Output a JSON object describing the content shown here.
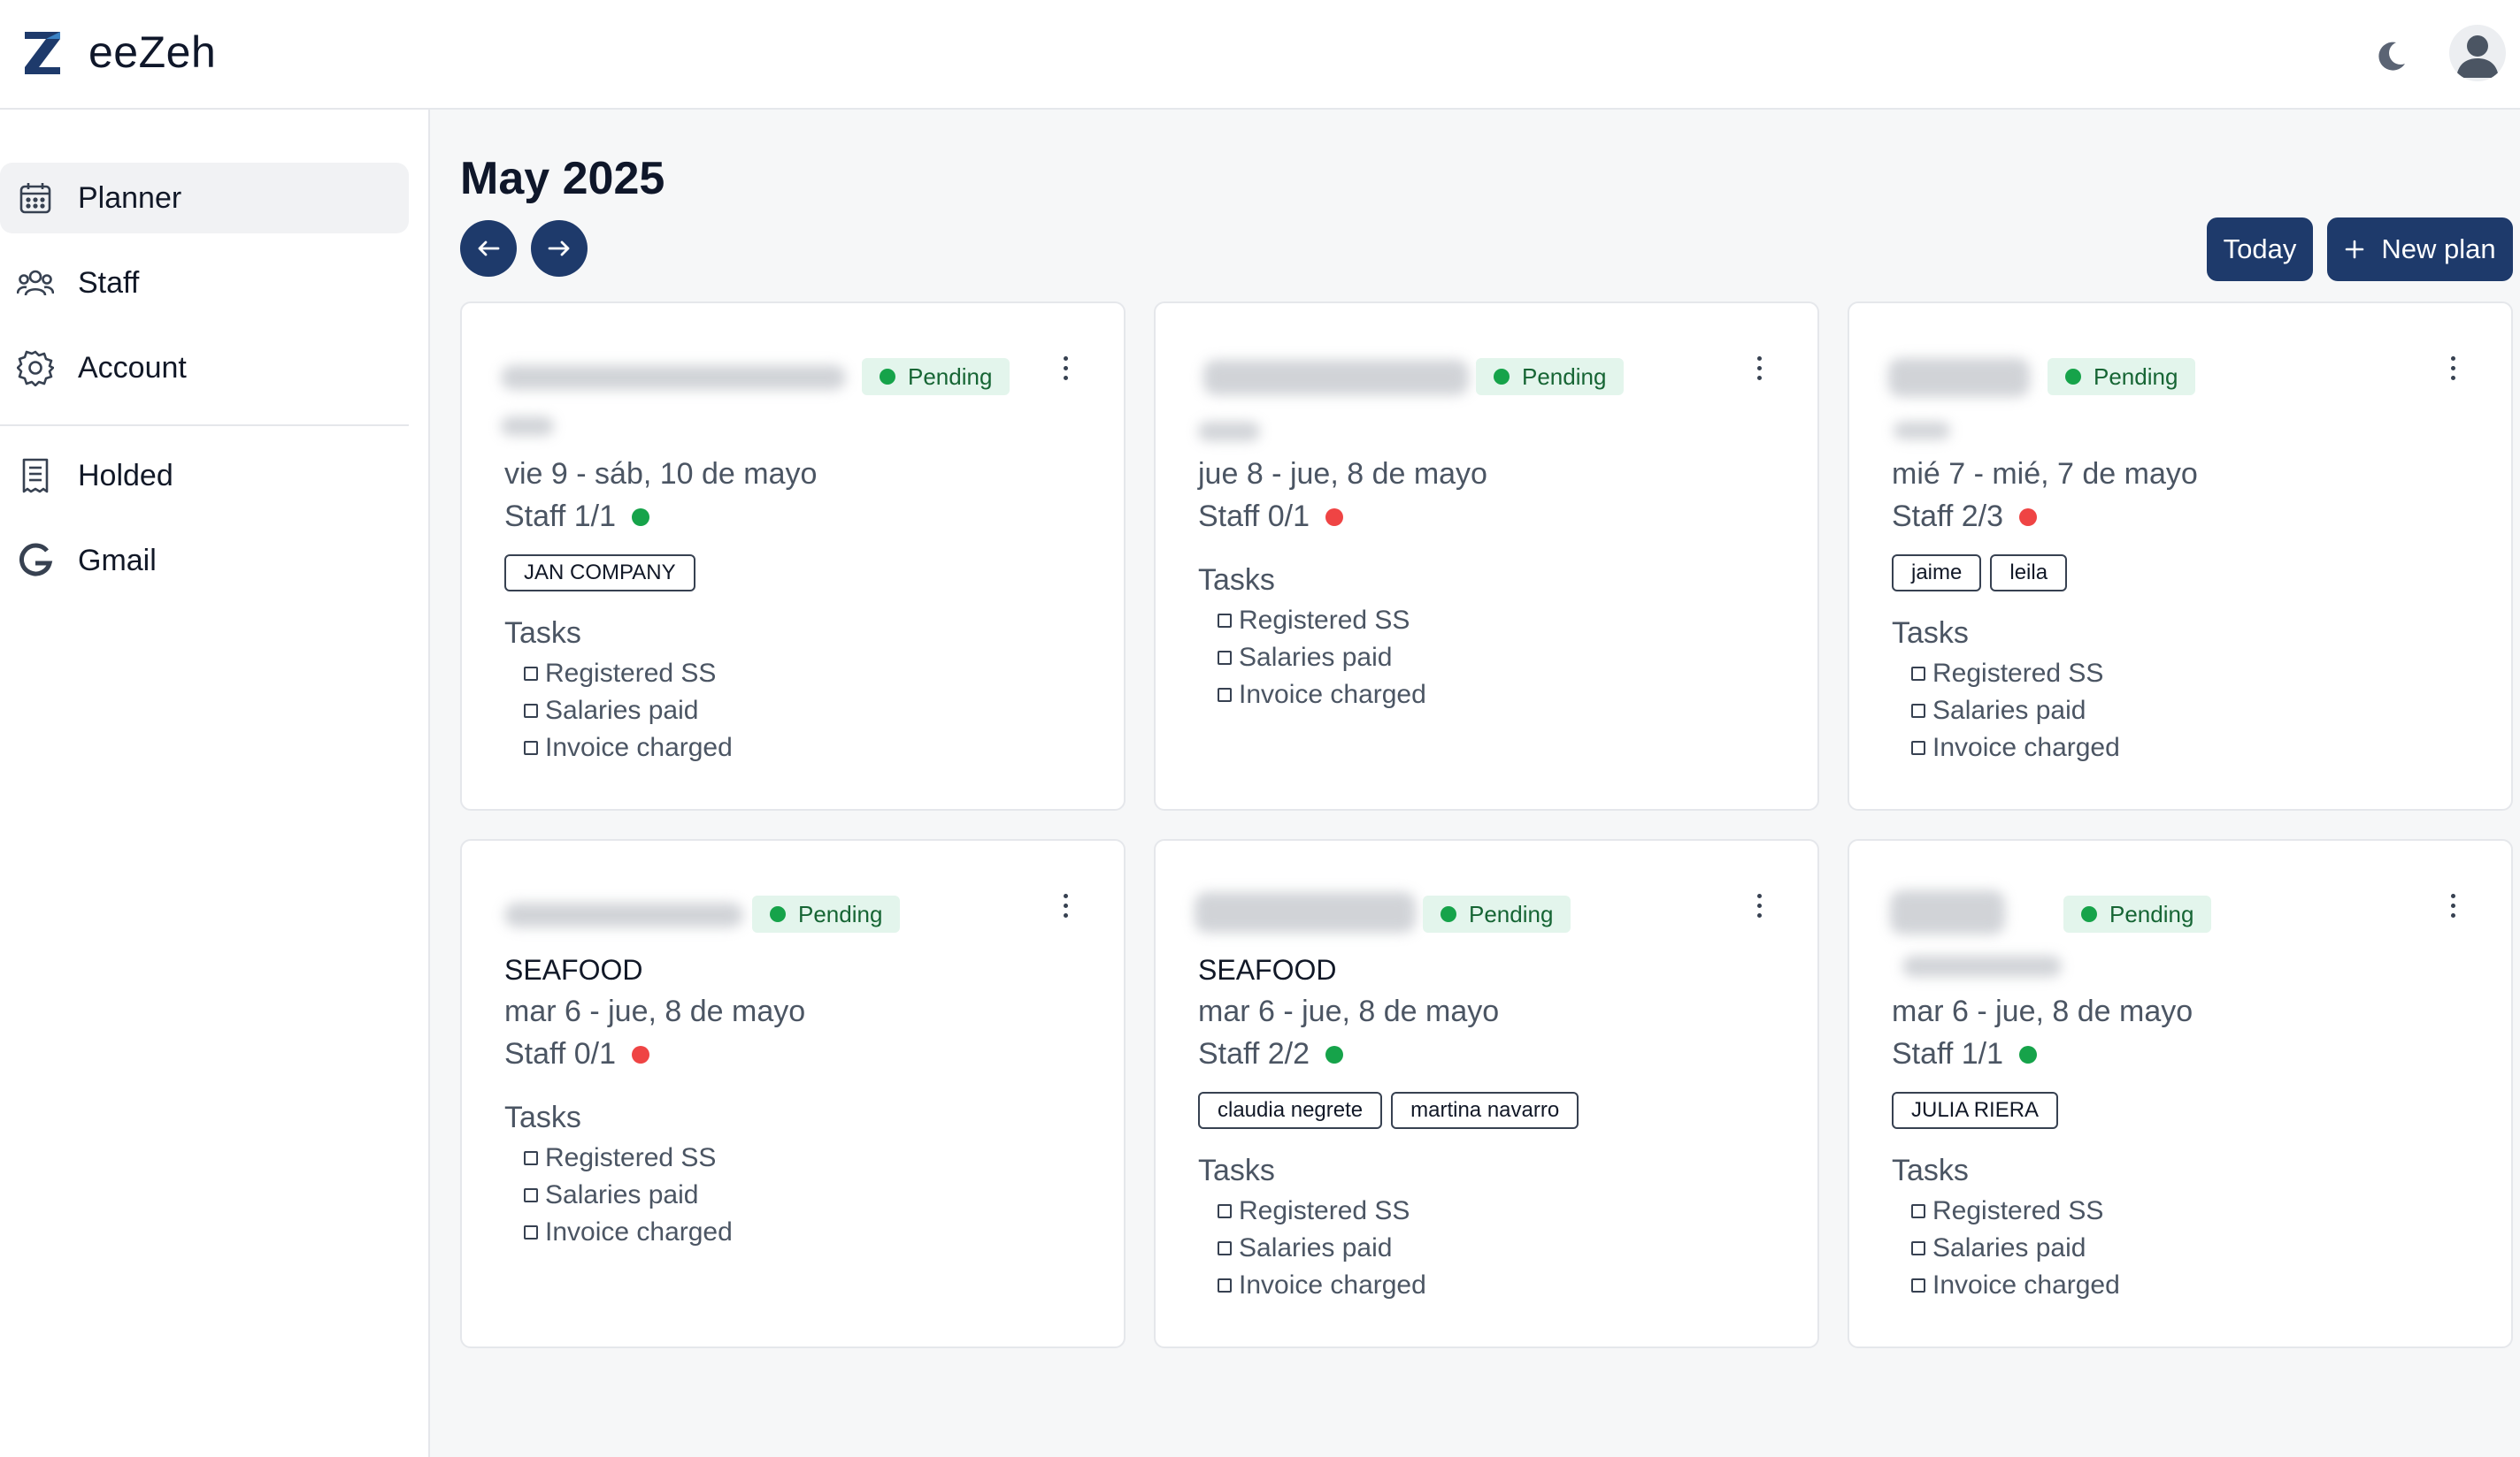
{
  "app": {
    "brand": "eeZeh",
    "theme_icon": "moon-icon",
    "user_icon": "user-avatar-icon",
    "accent_color": "#1e3a6b"
  },
  "sidebar": {
    "items": [
      {
        "label": "Planner",
        "icon": "calendar-icon",
        "active": true
      },
      {
        "label": "Staff",
        "icon": "users-icon",
        "active": false
      },
      {
        "label": "Account",
        "icon": "gear-icon",
        "active": false
      },
      {
        "label": "Holded",
        "icon": "document-icon",
        "active": false
      },
      {
        "label": "Gmail",
        "icon": "google-icon",
        "active": false
      }
    ]
  },
  "main": {
    "month_title": "May 2025",
    "prev_icon": "arrow-left-icon",
    "next_icon": "arrow-right-icon",
    "today_label": "Today",
    "new_plan_label": "New plan",
    "new_plan_icon": "plus-icon"
  },
  "cards": [
    {
      "status": "Pending",
      "client": "",
      "dates": "vie 9 - sáb, 10 de mayo",
      "staff": "Staff 1/1",
      "staff_ok": true,
      "chips": [
        "JAN COMPANY"
      ],
      "tasks_title": "Tasks",
      "tasks": [
        "Registered SS",
        "Salaries paid",
        "Invoice charged"
      ]
    },
    {
      "status": "Pending",
      "client": "",
      "dates": "jue 8 - jue, 8 de mayo",
      "staff": "Staff 0/1",
      "staff_ok": false,
      "chips": [],
      "tasks_title": "Tasks",
      "tasks": [
        "Registered SS",
        "Salaries paid",
        "Invoice charged"
      ]
    },
    {
      "status": "Pending",
      "client": "",
      "dates": "mié 7 - mié, 7 de mayo",
      "staff": "Staff 2/3",
      "staff_ok": false,
      "chips": [
        "jaime",
        "leila"
      ],
      "tasks_title": "Tasks",
      "tasks": [
        "Registered SS",
        "Salaries paid",
        "Invoice charged"
      ]
    },
    {
      "status": "Pending",
      "client": "SEAFOOD",
      "dates": "mar 6 - jue, 8 de mayo",
      "staff": "Staff 0/1",
      "staff_ok": false,
      "chips": [],
      "tasks_title": "Tasks",
      "tasks": [
        "Registered SS",
        "Salaries paid",
        "Invoice charged"
      ]
    },
    {
      "status": "Pending",
      "client": "SEAFOOD",
      "dates": "mar 6 - jue, 8 de mayo",
      "staff": "Staff 2/2",
      "staff_ok": true,
      "chips": [
        "claudia negrete",
        "martina navarro"
      ],
      "tasks_title": "Tasks",
      "tasks": [
        "Registered SS",
        "Salaries paid",
        "Invoice charged"
      ]
    },
    {
      "status": "Pending",
      "client": "",
      "dates": "mar 6 - jue, 8 de mayo",
      "staff": "Staff 1/1",
      "staff_ok": true,
      "chips": [
        "JULIA RIERA"
      ],
      "tasks_title": "Tasks",
      "tasks": [
        "Registered SS",
        "Salaries paid",
        "Invoice charged"
      ]
    }
  ]
}
